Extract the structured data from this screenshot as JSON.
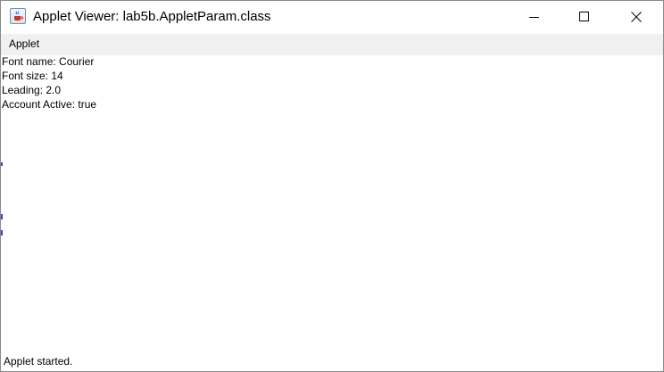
{
  "window": {
    "title": "Applet Viewer: lab5b.AppletParam.class",
    "app_icon": "java-cup-icon",
    "controls": [
      "minimize-icon",
      "maximize-icon",
      "close-icon"
    ]
  },
  "menubar": {
    "items": [
      {
        "label": "Applet"
      }
    ]
  },
  "applet": {
    "lines": [
      "Font name: Courier",
      "Font size: 14",
      "Leading: 2.0",
      "Account Active: true"
    ]
  },
  "status": {
    "text": "Applet started."
  },
  "colors": {
    "menubar_bg": "#f0f0f0",
    "window_border": "#8a8a8a",
    "text": "#000000"
  }
}
